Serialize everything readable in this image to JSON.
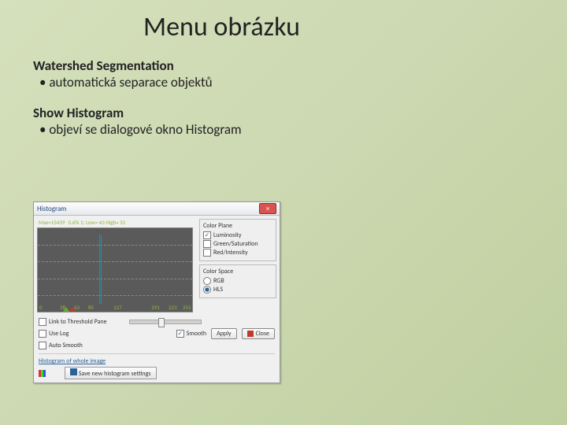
{
  "title": "Menu obrázku",
  "section1": {
    "heading": "Watershed Segmentation",
    "bullet": "automatická separace objektů"
  },
  "section2": {
    "heading": "Show Histogram",
    "bullet": "objeví se dialogové okno Histogram"
  },
  "dialog": {
    "title": "Histogram",
    "close": "×",
    "info": {
      "a": "Max=15439",
      "b": "0.6%   1:  Low= 43  High= 51"
    },
    "axis": [
      "0",
      "38",
      "63",
      "85",
      "127",
      "191",
      "223",
      "255"
    ],
    "colorPlane": {
      "title": "Color Plane",
      "items": [
        "Luminosity",
        "Green/Saturation",
        "Red/Intensity"
      ]
    },
    "colorSpace": {
      "title": "Color Space",
      "items": [
        "RGB",
        "HLS"
      ]
    },
    "opts": {
      "link": "Link to Threshold Pane",
      "log": "Use Log",
      "auto": "Auto Smooth",
      "smooth": "Smooth"
    },
    "buttons": {
      "apply": "Apply",
      "close": "Close",
      "save": "Save new histogram settings"
    },
    "linkText": "Histogram of whole image"
  }
}
